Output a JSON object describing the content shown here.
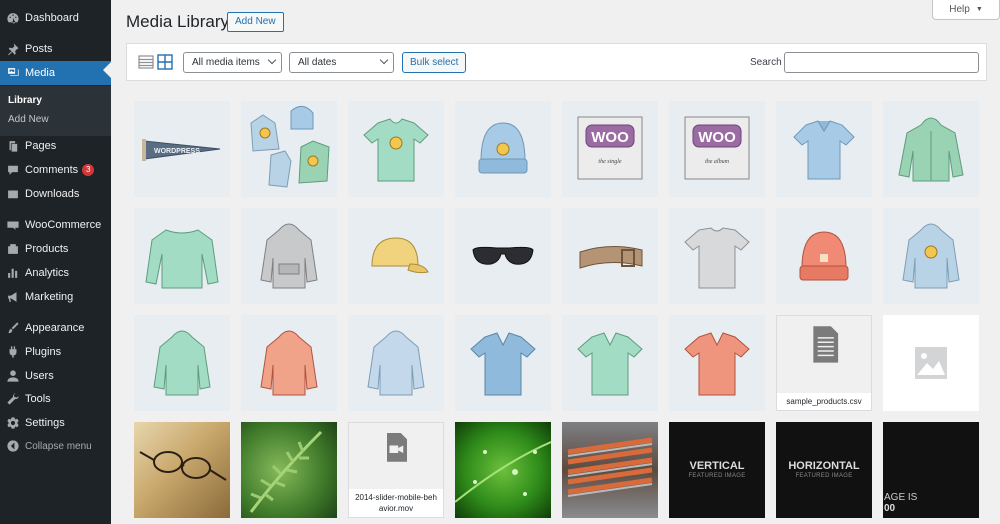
{
  "sidebar": {
    "dashboard": "Dashboard",
    "posts": "Posts",
    "media": "Media",
    "submenu": {
      "library": "Library",
      "add_new": "Add New"
    },
    "pages": "Pages",
    "comments": "Comments",
    "comments_count": "3",
    "downloads": "Downloads",
    "woocommerce": "WooCommerce",
    "products": "Products",
    "analytics": "Analytics",
    "marketing": "Marketing",
    "appearance": "Appearance",
    "plugins": "Plugins",
    "users": "Users",
    "tools": "Tools",
    "settings": "Settings",
    "collapse": "Collapse menu"
  },
  "header": {
    "title": "Media Library",
    "add_new": "Add New",
    "help": "Help"
  },
  "toolbar": {
    "filter_type": "All media items",
    "filter_date": "All dates",
    "bulk_select": "Bulk select",
    "search_label": "Search",
    "search_value": ""
  },
  "files": {
    "csv_name": "sample_products.csv",
    "video_name": "2014-slider-mobile-behavior.mov"
  },
  "featured": {
    "vertical_title": "VERTICAL",
    "vertical_sub": "FEATURED IMAGE",
    "horizontal_title": "HORIZONTAL",
    "horizontal_sub": "FEATURED IMAGE",
    "partial_line1": "AGE IS",
    "partial_line2": "00"
  },
  "logo_text": {
    "pennant": "WORDPRESS",
    "woo": "WOO",
    "single": "the single",
    "album": "the album"
  },
  "colors": {
    "sidebar_bg": "#1d2327",
    "accent": "#2271b1",
    "badge": "#d63638",
    "tile_bg": "#e8edf1"
  }
}
